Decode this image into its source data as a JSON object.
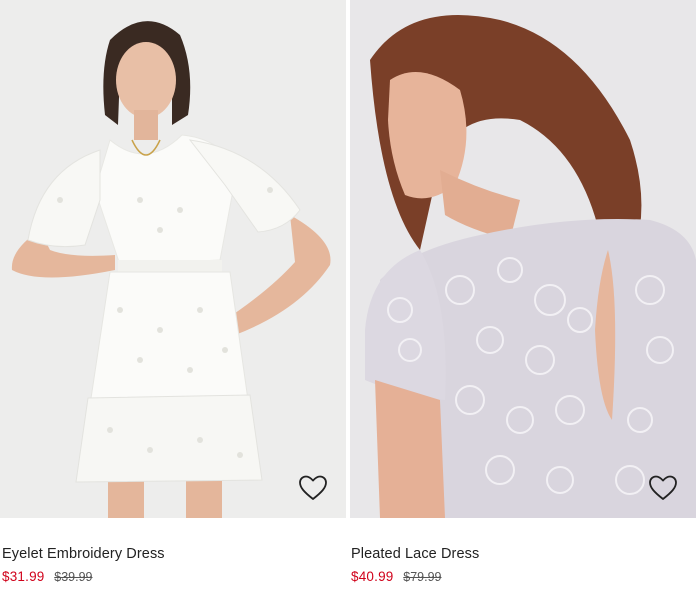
{
  "products": [
    {
      "name": "Eyelet Embroidery Dress",
      "sale_price": "$31.99",
      "original_price": "$39.99",
      "wishlist_icon": "heart-outline-icon"
    },
    {
      "name": "Pleated Lace Dress",
      "sale_price": "$40.99",
      "original_price": "$79.99",
      "wishlist_icon": "heart-outline-icon"
    }
  ],
  "colors": {
    "sale_price": "#d0021b",
    "original_price": "#555555",
    "title": "#222222"
  }
}
